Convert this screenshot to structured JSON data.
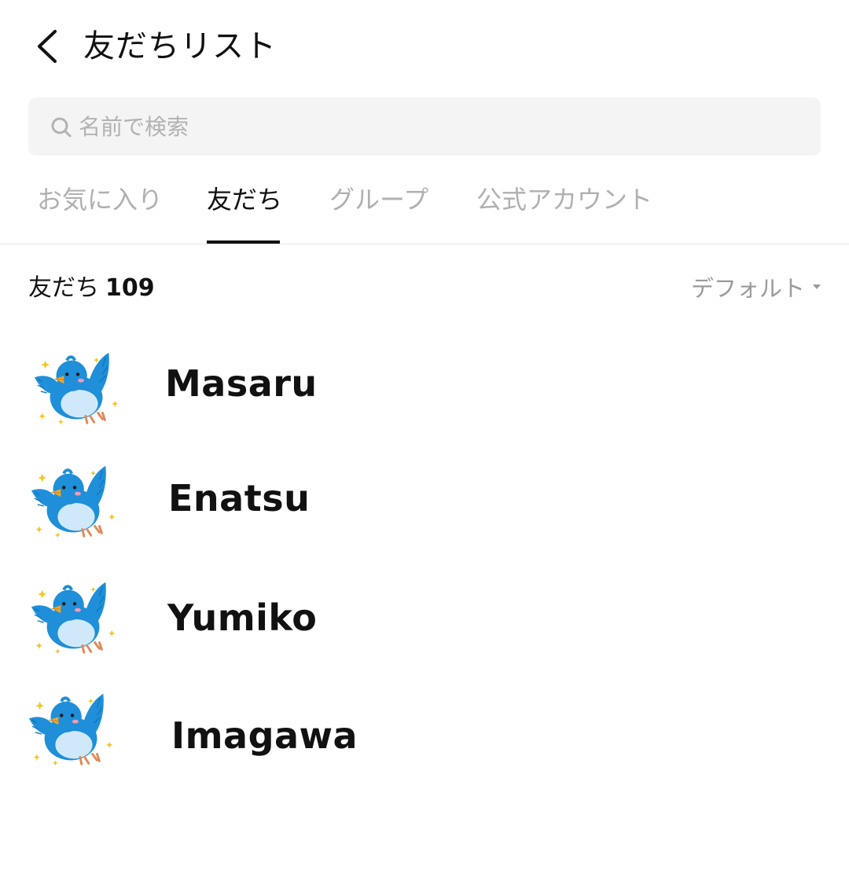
{
  "header": {
    "title": "友だちリスト",
    "back_icon": "chevron-left-icon"
  },
  "search": {
    "placeholder": "名前で検索",
    "value": "",
    "icon": "search-icon"
  },
  "tabs": [
    {
      "label": "お気に入り",
      "active": false
    },
    {
      "label": "友だち",
      "active": true
    },
    {
      "label": "グループ",
      "active": false
    },
    {
      "label": "公式アカウント",
      "active": false
    }
  ],
  "list_header": {
    "label": "友だち",
    "count": "109",
    "sort_label": "デフォルト",
    "sort_icon": "caret-down-icon"
  },
  "friends": [
    {
      "name": "Masaru",
      "avatar": "blue-bird-icon"
    },
    {
      "name": "Enatsu",
      "avatar": "blue-bird-icon"
    },
    {
      "name": "Yumiko",
      "avatar": "blue-bird-icon"
    },
    {
      "name": "Imagawa",
      "avatar": "blue-bird-icon"
    }
  ],
  "colors": {
    "bird_blue": "#1e8fd8",
    "bird_belly": "#cfe9fa",
    "beak": "#f5a623",
    "sparkle": "#f5c518",
    "tab_inactive": "#b0b0b0"
  }
}
